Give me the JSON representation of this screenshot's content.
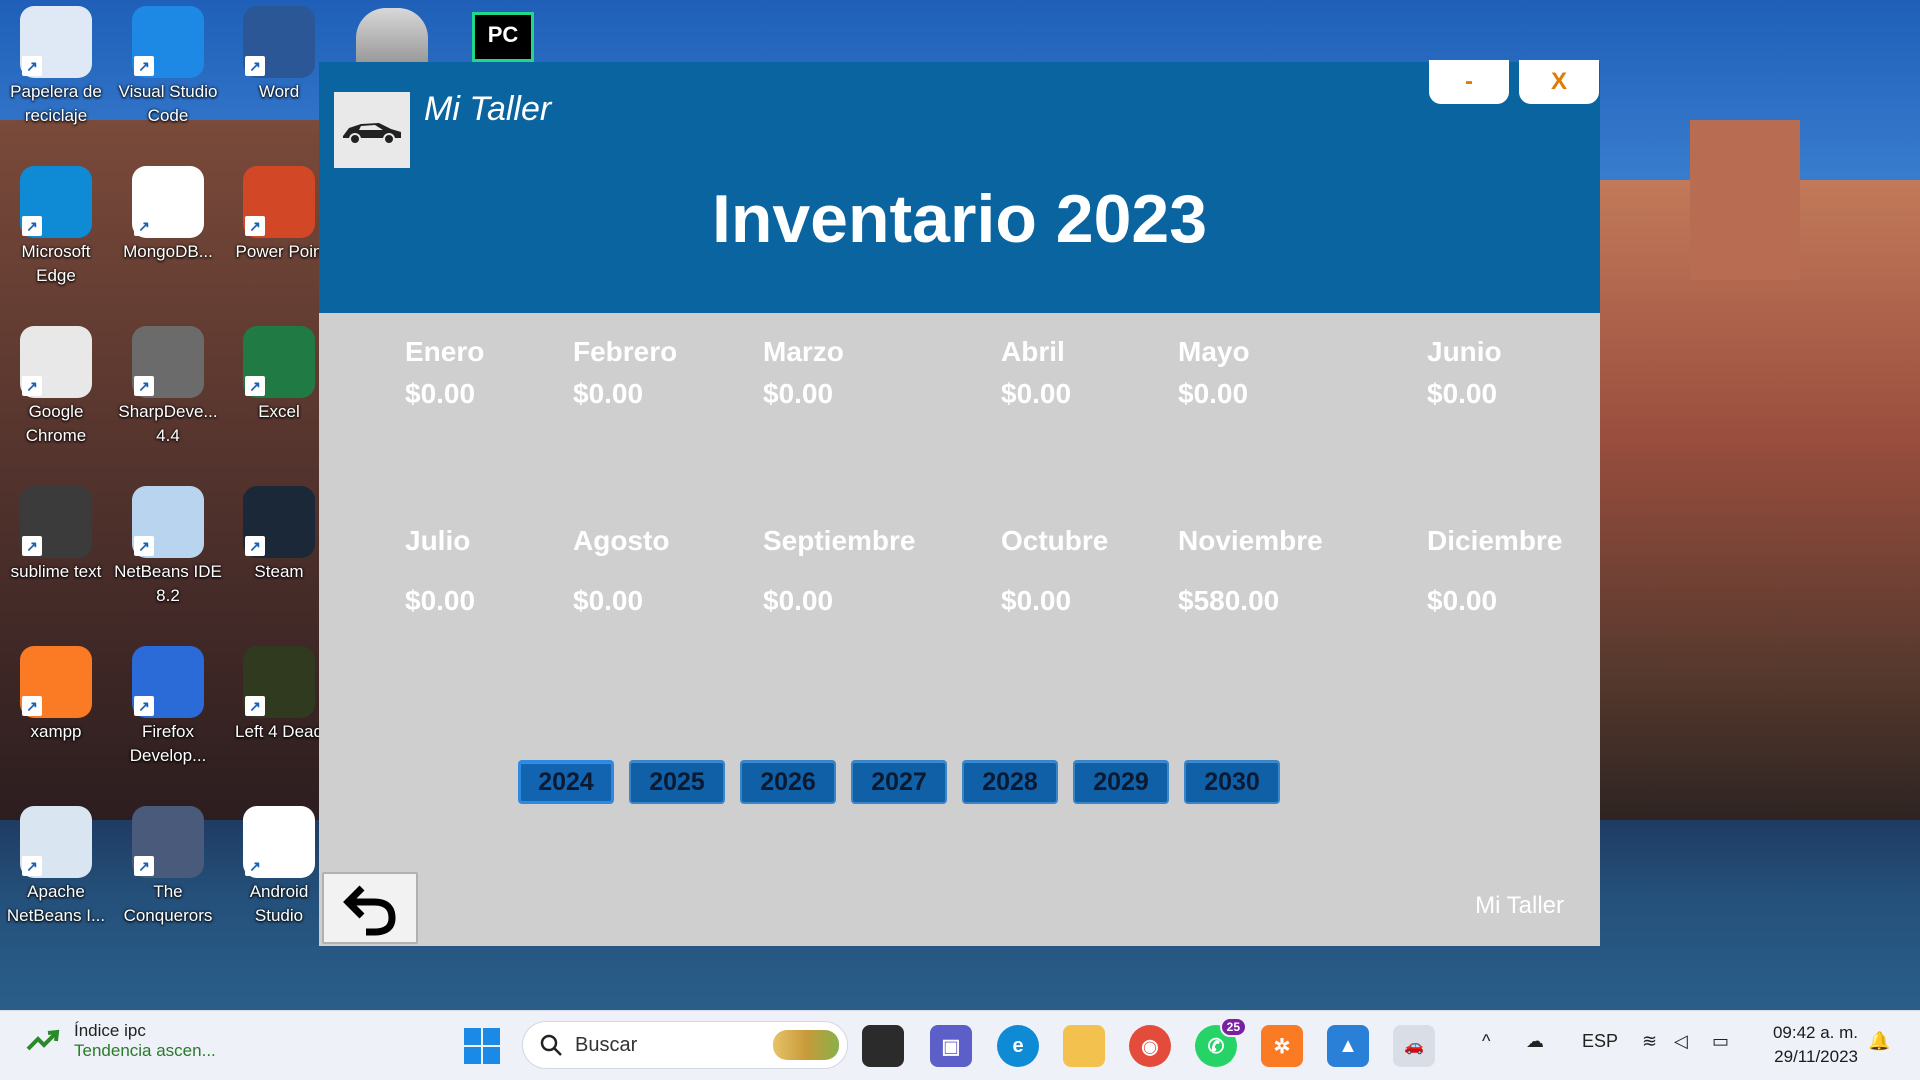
{
  "desktop": {
    "icons": [
      {
        "label": "Papelera de reciclaje",
        "icon": "recycle-bin-icon",
        "color": "#dfe8f5"
      },
      {
        "label": "Visual Studio Code",
        "icon": "vscode-icon",
        "color": "#1e88e5"
      },
      {
        "label": "Word",
        "icon": "word-icon",
        "color": "#2b5797"
      },
      {
        "label": "Microsoft Edge",
        "icon": "edge-icon",
        "color": "#0f8bd6"
      },
      {
        "label": "MongoDB...",
        "icon": "mongodb-icon",
        "color": "#ffffff"
      },
      {
        "label": "Power Poin",
        "icon": "powerpoint-icon",
        "color": "#d24726"
      },
      {
        "label": "Google Chrome",
        "icon": "chrome-icon",
        "color": "#e8e8e8"
      },
      {
        "label": "SharpDeve... 4.4",
        "icon": "sharpdevelop-icon",
        "color": "#6b6b6b"
      },
      {
        "label": "Excel",
        "icon": "excel-icon",
        "color": "#1f7a44"
      },
      {
        "label": "sublime text",
        "icon": "sublime-icon",
        "color": "#3b3b3b"
      },
      {
        "label": "NetBeans IDE 8.2",
        "icon": "netbeans-icon",
        "color": "#b8d4ee"
      },
      {
        "label": "Steam",
        "icon": "steam-icon",
        "color": "#1b2838"
      },
      {
        "label": "xampp",
        "icon": "xampp-icon",
        "color": "#fb7a24"
      },
      {
        "label": "Firefox Develop...",
        "icon": "firefox-dev-icon",
        "color": "#2a6bd8"
      },
      {
        "label": "Left 4 Dead",
        "icon": "left4dead-icon",
        "color": "#2f3a1f"
      },
      {
        "label": "Apache NetBeans I...",
        "icon": "apache-netbeans-icon",
        "color": "#d9e6f2"
      },
      {
        "label": "The Conquerors",
        "icon": "conquerors-icon",
        "color": "#4a5a7a"
      },
      {
        "label": "Android Studio",
        "icon": "android-studio-icon",
        "color": "#ffffff"
      }
    ],
    "top_partial_icons": [
      "database-icon",
      "pycharm-icon"
    ]
  },
  "app": {
    "title": "Mi Taller",
    "minimize_label": "-",
    "close_label": "X",
    "main_title": "Inventario 2023",
    "months": [
      {
        "name": "Enero",
        "amount": "$0.00"
      },
      {
        "name": "Febrero",
        "amount": "$0.00"
      },
      {
        "name": "Marzo",
        "amount": "$0.00"
      },
      {
        "name": "Abril",
        "amount": "$0.00"
      },
      {
        "name": "Mayo",
        "amount": "$0.00"
      },
      {
        "name": "Junio",
        "amount": "$0.00"
      },
      {
        "name": "Julio",
        "amount": "$0.00"
      },
      {
        "name": "Agosto",
        "amount": "$0.00"
      },
      {
        "name": "Septiembre",
        "amount": "$0.00"
      },
      {
        "name": "Octubre",
        "amount": "$0.00"
      },
      {
        "name": "Noviembre",
        "amount": "$580.00"
      },
      {
        "name": "Diciembre",
        "amount": "$0.00"
      }
    ],
    "years": [
      "2024",
      "2025",
      "2026",
      "2027",
      "2028",
      "2029",
      "2030"
    ],
    "footer_label": "Mi Taller",
    "colors": {
      "header": "#0a64a0",
      "body": "#cfcfcf",
      "accent": "#e07d00",
      "year_button": "#1060a8"
    }
  },
  "taskbar": {
    "widget_title": "Índice ipc",
    "widget_subtitle": "Tendencia ascen...",
    "search_placeholder": "Buscar",
    "whatsapp_badge": "25",
    "language": "ESP",
    "time": "09:42 a. m.",
    "date": "29/11/2023"
  }
}
